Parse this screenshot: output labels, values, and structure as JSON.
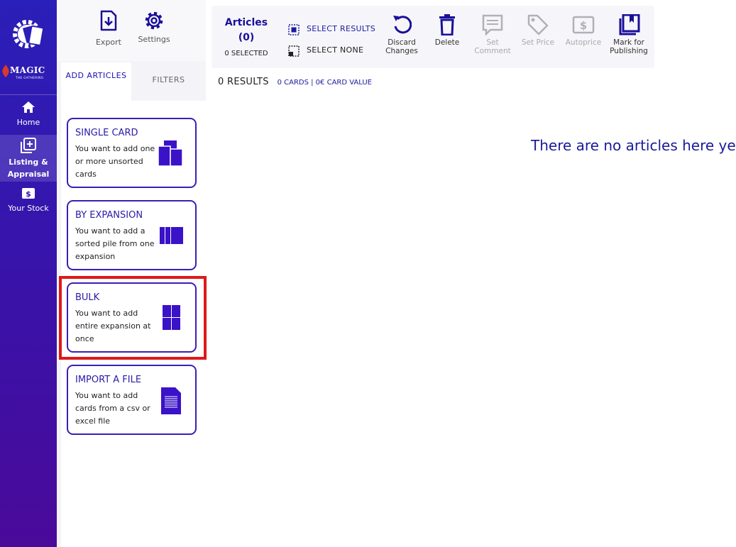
{
  "nav": {
    "brand_word": "MAGIC",
    "brand_sub": "THE GATHERING",
    "items": [
      {
        "label": "Home",
        "icon": "home-icon"
      },
      {
        "label": "Listing & Appraisal",
        "icon": "add-box-icon",
        "active": true
      },
      {
        "label": "Your Stock",
        "icon": "money-icon"
      }
    ]
  },
  "panel": {
    "tools": [
      {
        "label": "Export",
        "icon": "export-icon"
      },
      {
        "label": "Settings",
        "icon": "gear-icon"
      }
    ],
    "tabs": {
      "add_articles": "ADD ARTICLES",
      "filters": "FILTERS"
    },
    "cards": [
      {
        "title": "SINGLE CARD",
        "desc": "You want to add one or more unsorted cards",
        "icon": "cards-stack-icon"
      },
      {
        "title": "BY EXPANSION",
        "desc": "You want to add a sorted pile from one expansion",
        "icon": "columns-icon"
      },
      {
        "title": "BULK",
        "desc": "You want to add entire expansion at once",
        "icon": "grid-icon"
      },
      {
        "title": "IMPORT A FILE",
        "desc": "You want to add cards from a csv or excel file",
        "icon": "file-icon"
      }
    ]
  },
  "toolbar": {
    "articles_title": "Articles",
    "articles_count": "(0)",
    "selected": "0 SELECTED",
    "select_results": "SELECT RESULTS",
    "select_none": "SELECT NONE",
    "buttons": [
      {
        "label": "Discard Changes",
        "icon": "undo-icon",
        "enabled": true
      },
      {
        "label": "Delete",
        "icon": "trash-icon",
        "enabled": true
      },
      {
        "label": "Set Comment",
        "icon": "comment-icon",
        "enabled": false
      },
      {
        "label": "Set Price",
        "icon": "tag-icon",
        "enabled": false
      },
      {
        "label": "Autoprice",
        "icon": "dollar-icon",
        "enabled": false
      },
      {
        "label": "Mark for Publishing",
        "icon": "publish-icon",
        "enabled": true
      }
    ]
  },
  "results": {
    "count": "0 RESULTS",
    "stats": "0 CARDS | 0€ CARD VALUE"
  },
  "empty_message": "There are no articles here yet.",
  "colors": {
    "accent": "#2a1aa8",
    "highlight": "#e01818",
    "nav_top": "#2a1fb8",
    "nav_bottom": "#4a0a9a"
  }
}
